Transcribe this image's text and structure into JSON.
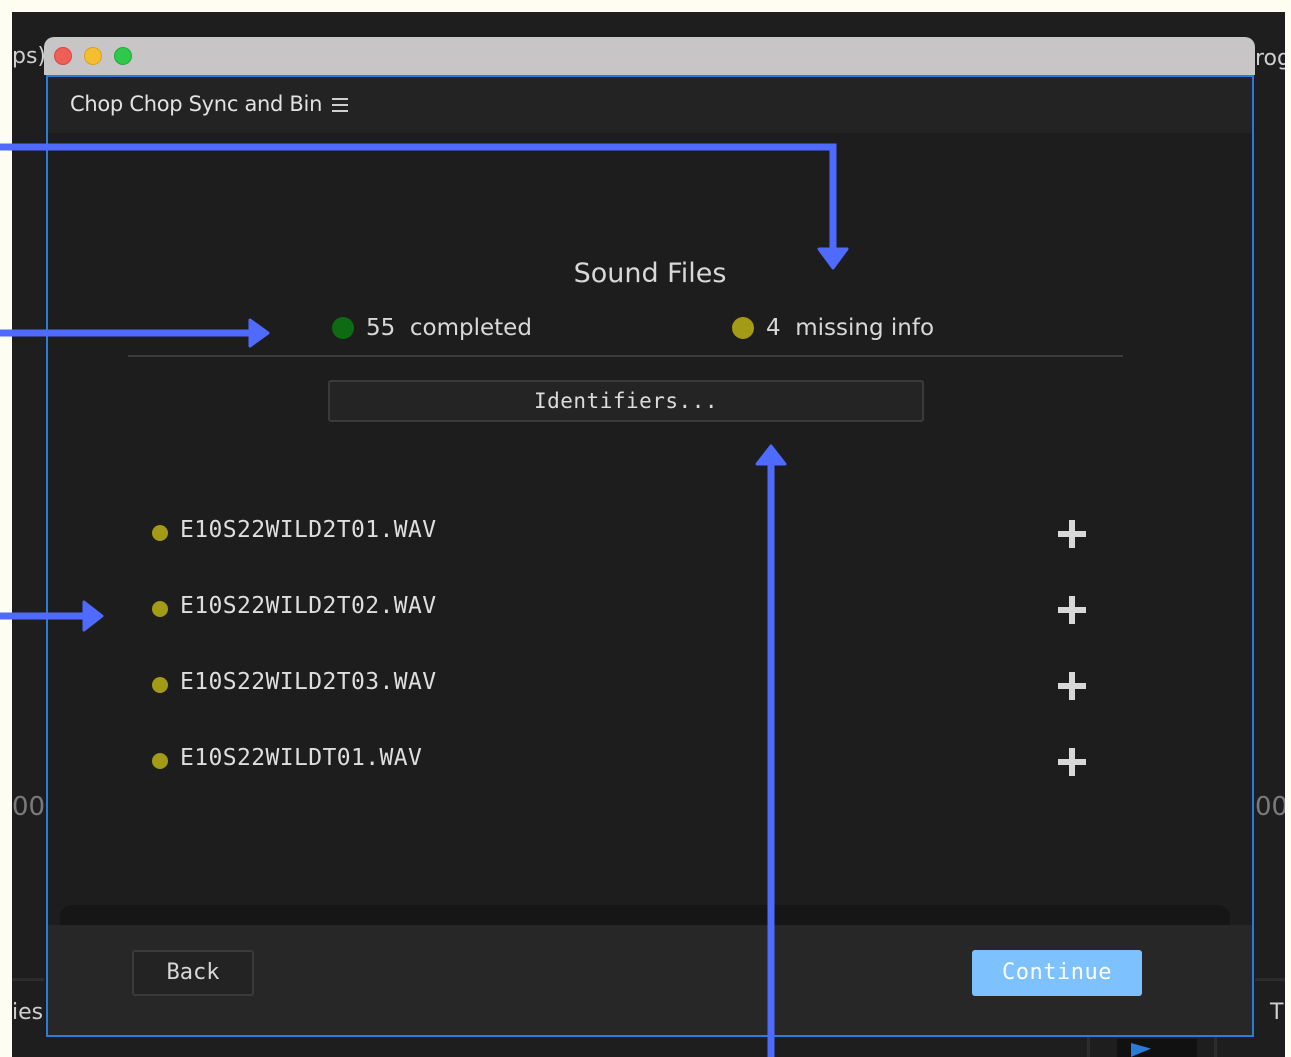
{
  "background": {
    "left_title_fragment": "ps)",
    "right_title_fragment": "rog",
    "left_value_fragment": "00",
    "right_value_fragment": "00",
    "left_bottom_fragment": "ies",
    "right_bottom_fragment": "T"
  },
  "panel": {
    "title": "Chop Chop Sync and Bin",
    "menu_icon": "hamburger-icon"
  },
  "sound_files": {
    "heading": "Sound Files",
    "completed_count": "55",
    "completed_label": "completed",
    "missing_count": "4",
    "missing_label": "missing info",
    "identifiers_button": "Identifiers..."
  },
  "files": [
    {
      "name": "E10S22WILD2T01.WAV"
    },
    {
      "name": "E10S22WILD2T02.WAV"
    },
    {
      "name": "E10S22WILD2T03.WAV"
    },
    {
      "name": "E10S22WILDT01.WAV"
    }
  ],
  "footer": {
    "back_label": "Back",
    "continue_label": "Continue"
  },
  "colors": {
    "completed_dot": "#0e6b14",
    "missing_dot": "#a39a16",
    "continue_button": "#7ec1ff",
    "panel_border": "#2b7bd8",
    "annotation_arrow": "#4f6bff"
  }
}
